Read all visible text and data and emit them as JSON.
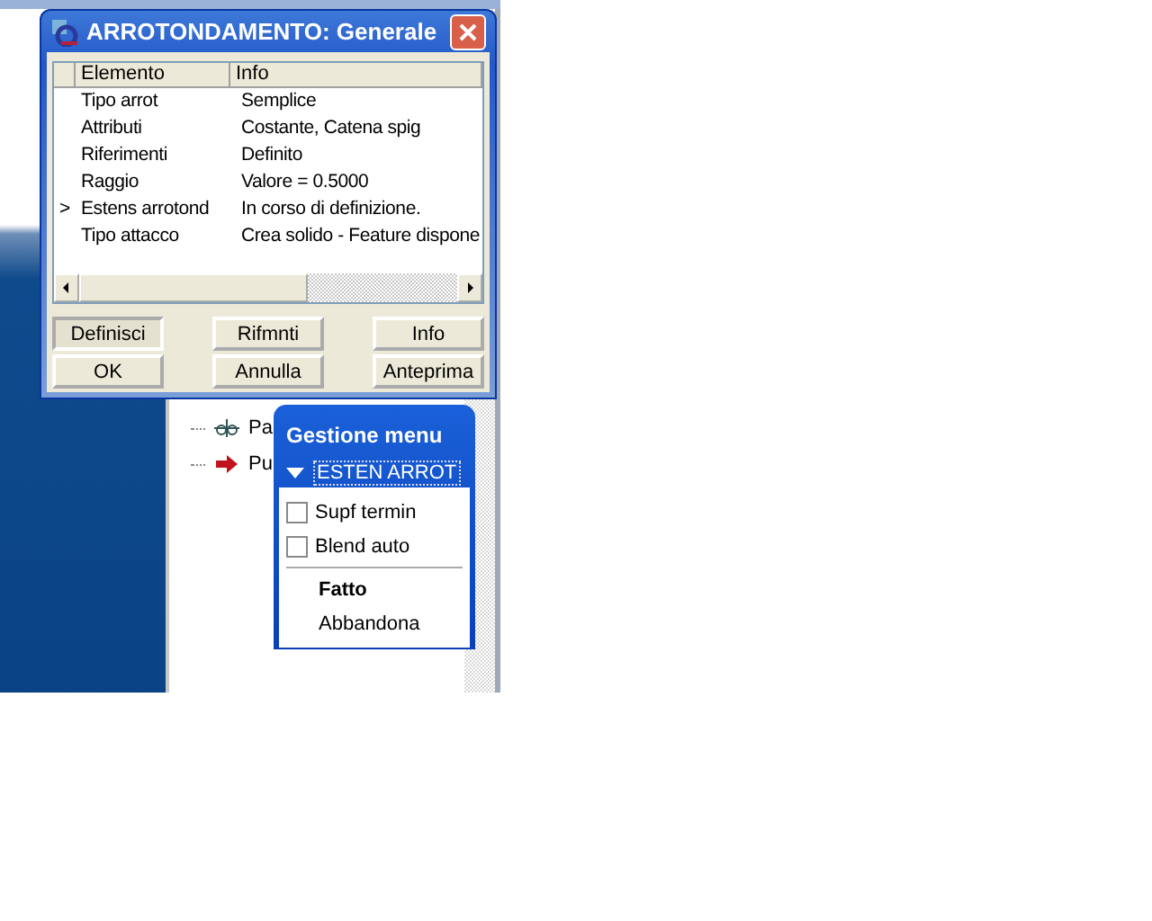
{
  "tree": {
    "items": [
      {
        "label": "Pa",
        "kind": "feature"
      },
      {
        "label": "Pu",
        "kind": "arrow"
      }
    ]
  },
  "dialog": {
    "title": "ARROTONDAMENTO: Generale",
    "columns": [
      "Elemento",
      "Info"
    ],
    "rows": [
      {
        "element": "Tipo arrot",
        "info": "Semplice"
      },
      {
        "element": "Attributi",
        "info": "Costante, Catena spig"
      },
      {
        "element": "Riferimenti",
        "info": "Definito"
      },
      {
        "element": "Raggio",
        "info": "Valore = 0.5000"
      },
      {
        "element": "Estens arrotond",
        "info": "In corso di definizione.",
        "marker": ">"
      },
      {
        "element": "Tipo attacco",
        "info": "Crea solido - Feature dispone"
      }
    ],
    "buttons": [
      {
        "label": "Definisci",
        "pressed": true
      },
      {
        "label": "Rifmnti",
        "pressed": false
      },
      {
        "label": "Info",
        "pressed": false
      },
      {
        "label": "OK",
        "pressed": false
      },
      {
        "label": "Annulla",
        "pressed": false
      },
      {
        "label": "Anteprima",
        "pressed": false
      }
    ]
  },
  "menu": {
    "title": "Gestione menu",
    "section": "ESTEN ARROT",
    "items": [
      {
        "kind": "checkbox",
        "label": "Supf termin",
        "checked": false
      },
      {
        "kind": "checkbox",
        "label": "Blend auto",
        "checked": false
      },
      {
        "kind": "divider"
      },
      {
        "kind": "command",
        "label": "Fatto",
        "default": true
      },
      {
        "kind": "command",
        "label": "Abbandona",
        "default": false
      }
    ]
  }
}
